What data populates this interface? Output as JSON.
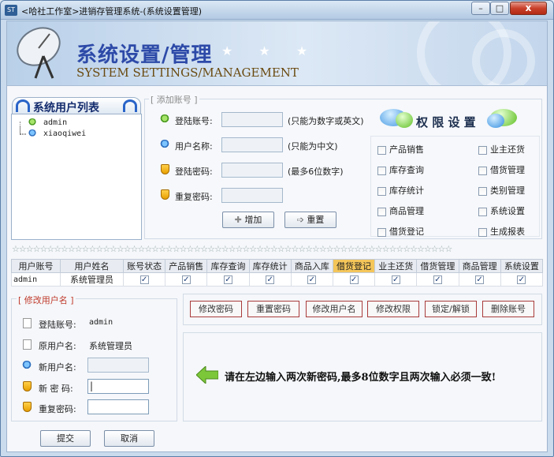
{
  "window": {
    "title": "<哈社工作室>进销存管理系统-(系统设置管理)",
    "icon": "app-icon",
    "min": "–",
    "max": "□",
    "close": "x"
  },
  "banner": {
    "title": "系统设置/管理",
    "subtitle": "SYSTEM SETTINGS/MANAGEMENT",
    "stars": "★ ★ ★"
  },
  "userlist": {
    "title": "系统用户列表",
    "users": [
      "admin",
      "xiaoqiwei"
    ]
  },
  "addaccount": {
    "legend": "[ 添加账号 ]",
    "login_label": "登陆账号:",
    "login_hint": "(只能为数字或英文)",
    "name_label": "用户名称:",
    "name_hint": "(只能为中文)",
    "pwd_label": "登陆密码:",
    "pwd_hint": "(最多6位数字)",
    "repwd_label": "重复密码:",
    "add_button": "增加",
    "reset_button": "重置"
  },
  "permissions": {
    "title": "权 限 设 置",
    "items": [
      "产品销售",
      "业主还货",
      "库存查询",
      "借货管理",
      "库存统计",
      "类别管理",
      "商品管理",
      "系统设置",
      "借货登记",
      "生成报表"
    ]
  },
  "divider": "☆☆☆☆☆☆☆☆☆☆☆☆☆☆☆☆☆☆☆☆☆☆☆☆☆☆☆☆☆☆☆☆☆☆☆☆☆☆☆☆☆☆☆☆☆☆☆☆☆☆☆☆☆☆☆☆☆☆☆☆☆☆☆",
  "table": {
    "columns": [
      "用户账号",
      "用户姓名",
      "账号状态",
      "产品销售",
      "库存查询",
      "库存统计",
      "商品入库",
      "借货登记",
      "业主还货",
      "借货管理",
      "商品管理",
      "系统设置"
    ],
    "highlight_column": "借货登记",
    "rows": [
      {
        "account": "admin",
        "name": "系统管理员",
        "checks": [
          true,
          true,
          true,
          true,
          true,
          true,
          true,
          true,
          true,
          true
        ]
      }
    ]
  },
  "editname": {
    "legend": "[ 修改用户名 ]",
    "login_label": "登陆账号:",
    "login_value": "admin",
    "old_label": "原用户名:",
    "old_value": "系统管理员",
    "new_label": "新用户名:",
    "new_pwd_label": "新 密 码:",
    "new_pwd_value": "|",
    "repwd_label": "重复密码:",
    "submit": "提交",
    "cancel": "取消"
  },
  "actions": [
    "修改密码",
    "重置密码",
    "修改用户名",
    "修改权限",
    "锁定/解锁",
    "删除账号"
  ],
  "message": "请在左边输入两次新密码,最多8位数字且两次输入必须一致!"
}
